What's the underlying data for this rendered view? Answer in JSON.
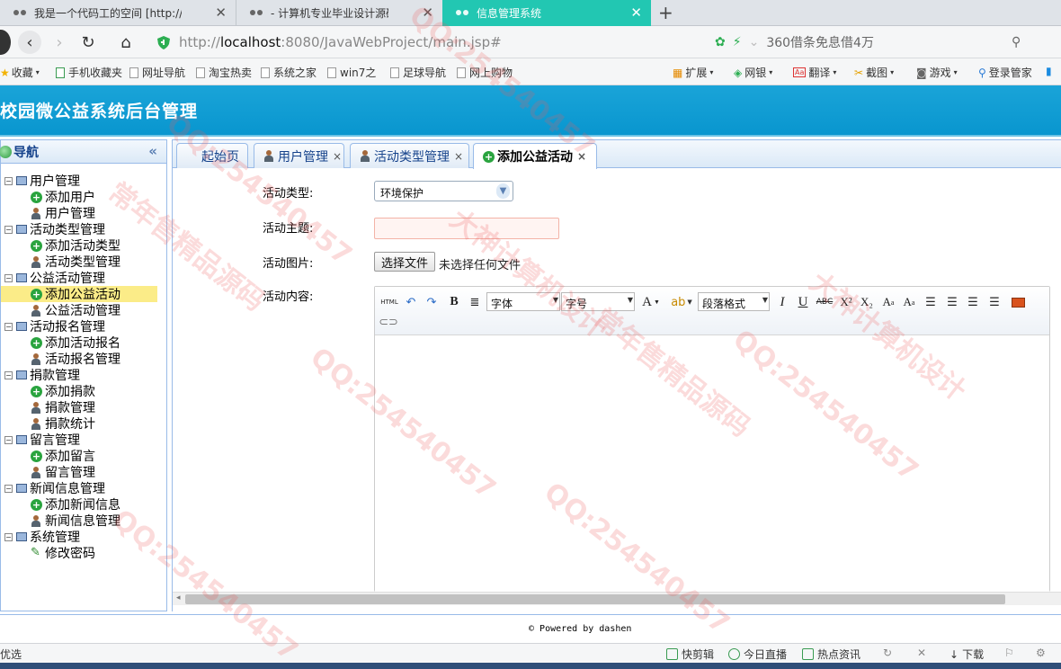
{
  "browser": {
    "tabs": [
      {
        "label": "我是一个代码工的空间 [http://2",
        "active": false
      },
      {
        "label": "- 计算机专业毕业设计源码网",
        "active": false
      },
      {
        "label": "信息管理系统",
        "active": true
      }
    ],
    "new_tab": "+",
    "url_scheme": "http://",
    "url_host": "localhost",
    "url_path": ":8080/JavaWebProject/main.jsp#",
    "address_right_text": "360借条免息借4万",
    "favorites": [
      "收藏",
      "手机收藏夹",
      "网址导航",
      "淘宝热卖",
      "系统之家",
      "win7之",
      "足球导航",
      "网上购物"
    ],
    "favorites_right": [
      "扩展",
      "网银",
      "翻译",
      "截图",
      "游戏",
      "登录管家"
    ]
  },
  "app": {
    "title": "校园微公益系统后台管理",
    "accent_color": "#0f9ed6"
  },
  "nav": {
    "title": "导航",
    "groups": [
      {
        "label": "用户管理",
        "items": [
          {
            "label": "添加用户",
            "icon": "add-icon"
          },
          {
            "label": "用户管理",
            "icon": "user-icon"
          }
        ]
      },
      {
        "label": "活动类型管理",
        "items": [
          {
            "label": "添加活动类型",
            "icon": "add-icon"
          },
          {
            "label": "活动类型管理",
            "icon": "user-icon"
          }
        ]
      },
      {
        "label": "公益活动管理",
        "items": [
          {
            "label": "添加公益活动",
            "icon": "add-icon",
            "selected": true
          },
          {
            "label": "公益活动管理",
            "icon": "user-icon"
          }
        ]
      },
      {
        "label": "活动报名管理",
        "items": [
          {
            "label": "添加活动报名",
            "icon": "add-icon"
          },
          {
            "label": "活动报名管理",
            "icon": "user-icon"
          }
        ]
      },
      {
        "label": "捐款管理",
        "items": [
          {
            "label": "添加捐款",
            "icon": "add-icon"
          },
          {
            "label": "捐款管理",
            "icon": "user-icon"
          },
          {
            "label": "捐款统计",
            "icon": "user-icon"
          }
        ]
      },
      {
        "label": "留言管理",
        "items": [
          {
            "label": "添加留言",
            "icon": "add-icon"
          },
          {
            "label": "留言管理",
            "icon": "user-icon"
          }
        ]
      },
      {
        "label": "新闻信息管理",
        "items": [
          {
            "label": "添加新闻信息",
            "icon": "add-icon"
          },
          {
            "label": "新闻信息管理",
            "icon": "user-icon"
          }
        ]
      },
      {
        "label": "系统管理",
        "items": [
          {
            "label": "修改密码",
            "icon": "pen-icon"
          }
        ]
      }
    ]
  },
  "content_tabs": [
    {
      "label": "起始页",
      "closable": false,
      "active": false
    },
    {
      "label": "用户管理",
      "closable": true,
      "active": false
    },
    {
      "label": "活动类型管理",
      "closable": true,
      "active": false
    },
    {
      "label": "添加公益活动",
      "closable": true,
      "active": true
    }
  ],
  "form": {
    "type_label": "活动类型:",
    "type_value": "环境保护",
    "title_label": "活动主题:",
    "title_value": "",
    "image_label": "活动图片:",
    "file_button": "选择文件",
    "file_status": "未选择任何文件",
    "content_label": "活动内容:",
    "editor": {
      "html_btn": "HTML",
      "bold": "B",
      "font_family": "字体",
      "font_size": "字号",
      "font_color": "A",
      "paragraph": "段落格式",
      "italic": "I",
      "underline": "U",
      "strike": "ABC",
      "superscript": "X²",
      "subscript": "X₂"
    }
  },
  "footer": {
    "powered": "Powered by dashen"
  },
  "statusbar": {
    "left": "优选",
    "items": [
      "快剪辑",
      "今日直播",
      "热点资讯",
      "下载"
    ]
  },
  "watermarks": [
    "QQ:254540457",
    "大神计算机设计",
    "常年售精品源码"
  ]
}
